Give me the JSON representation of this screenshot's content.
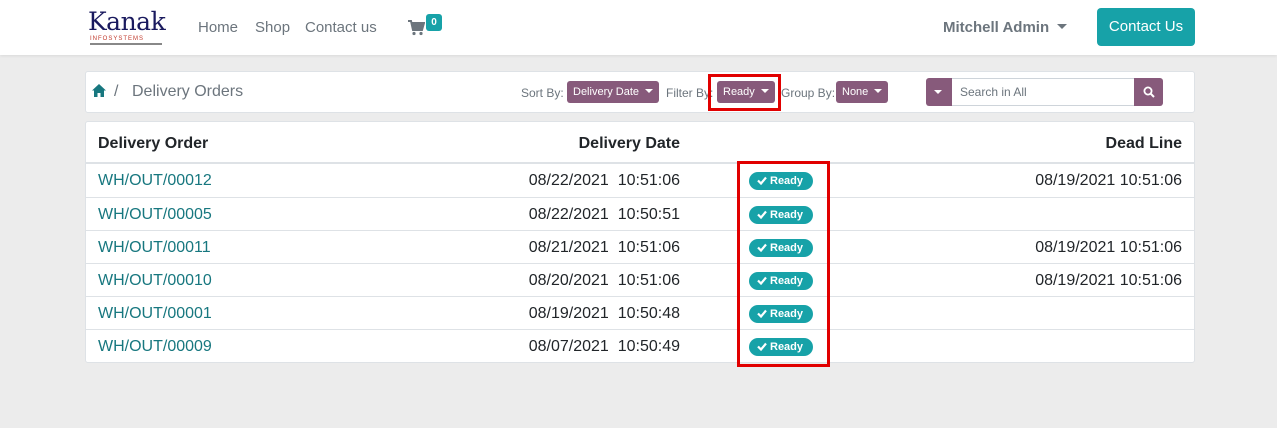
{
  "nav": {
    "logo_text": "Kanak",
    "logo_subtext": "INFOSYSTEMS",
    "links": [
      "Home",
      "Shop",
      "Contact us"
    ],
    "cart_count": "0",
    "user_name": "Mitchell Admin",
    "contact_button": "Contact Us"
  },
  "controls": {
    "breadcrumb_sep": "/",
    "breadcrumb_title": "Delivery Orders",
    "sort_label": "Sort By:",
    "sort_value": "Delivery Date",
    "filter_label": "Filter By:",
    "filter_value": "Ready",
    "group_label": "Group By:",
    "group_value": "None",
    "search_placeholder": "Search in All"
  },
  "table": {
    "headers": {
      "order": "Delivery Order",
      "date": "Delivery Date",
      "deadline": "Dead Line"
    },
    "rows": [
      {
        "order": "WH/OUT/00012",
        "date": "08/22/2021  10:51:06",
        "status": "Ready",
        "deadline": "08/19/2021 10:51:06"
      },
      {
        "order": "WH/OUT/00005",
        "date": "08/22/2021  10:50:51",
        "status": "Ready",
        "deadline": ""
      },
      {
        "order": "WH/OUT/00011",
        "date": "08/21/2021  10:51:06",
        "status": "Ready",
        "deadline": "08/19/2021 10:51:06"
      },
      {
        "order": "WH/OUT/00010",
        "date": "08/20/2021  10:51:06",
        "status": "Ready",
        "deadline": "08/19/2021 10:51:06"
      },
      {
        "order": "WH/OUT/00001",
        "date": "08/19/2021  10:50:48",
        "status": "Ready",
        "deadline": ""
      },
      {
        "order": "WH/OUT/00009",
        "date": "08/07/2021  10:50:49",
        "status": "Ready",
        "deadline": ""
      }
    ]
  },
  "colors": {
    "primary": "#875a7b",
    "accent": "#17a2a8",
    "link": "#17777f",
    "highlight": "#e10000"
  },
  "icons": [
    "home-icon",
    "cart-icon",
    "search-icon",
    "check-icon",
    "caret-down-icon"
  ]
}
